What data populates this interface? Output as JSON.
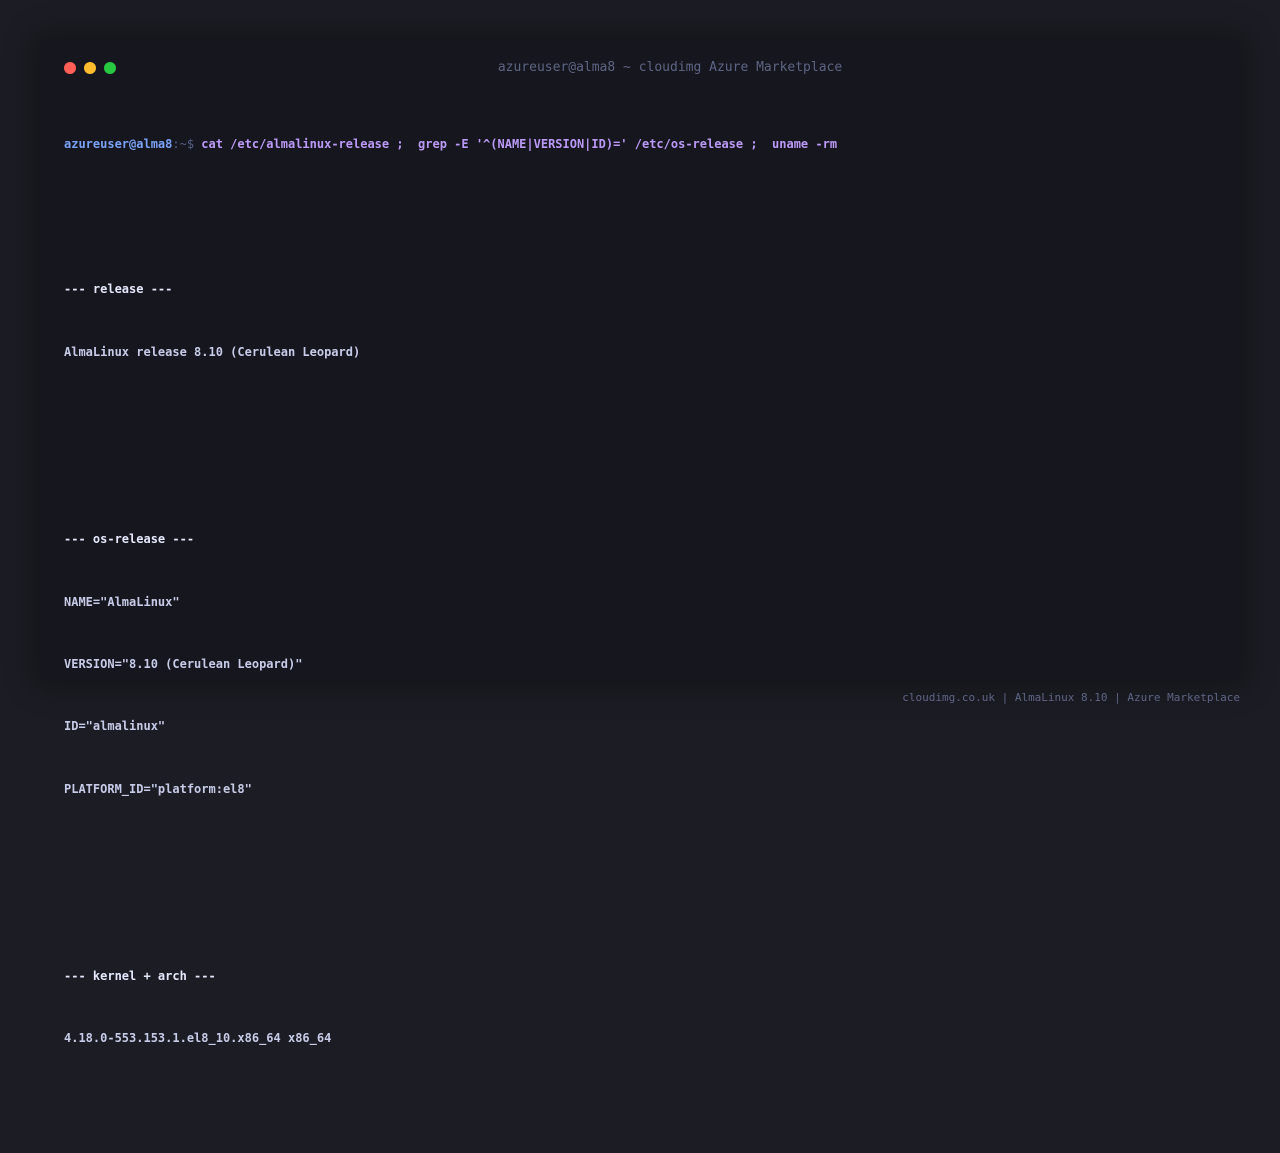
{
  "window": {
    "title": "azureuser@alma8 ~ cloudimg Azure Marketplace"
  },
  "prompt": {
    "user_host": "azureuser@alma8",
    "path_symbol": ":~$ ",
    "command": "cat /etc/almalinux-release ;  grep -E '^(NAME|VERSION|ID)=' /etc/os-release ;  uname -rm"
  },
  "output": {
    "release": {
      "header": "--- release ---",
      "lines": [
        "AlmaLinux release 8.10 (Cerulean Leopard)"
      ]
    },
    "os_release": {
      "header": "--- os-release ---",
      "lines": [
        "NAME=\"AlmaLinux\"",
        "VERSION=\"8.10 (Cerulean Leopard)\"",
        "ID=\"almalinux\"",
        "PLATFORM_ID=\"platform:el8\""
      ]
    },
    "kernel": {
      "header": "--- kernel + arch ---",
      "lines": [
        "4.18.0-553.153.1.el8_10.x86_64 x86_64"
      ]
    }
  },
  "footer": {
    "text": "cloudimg.co.uk | AlmaLinux 8.10 | Azure Marketplace"
  }
}
